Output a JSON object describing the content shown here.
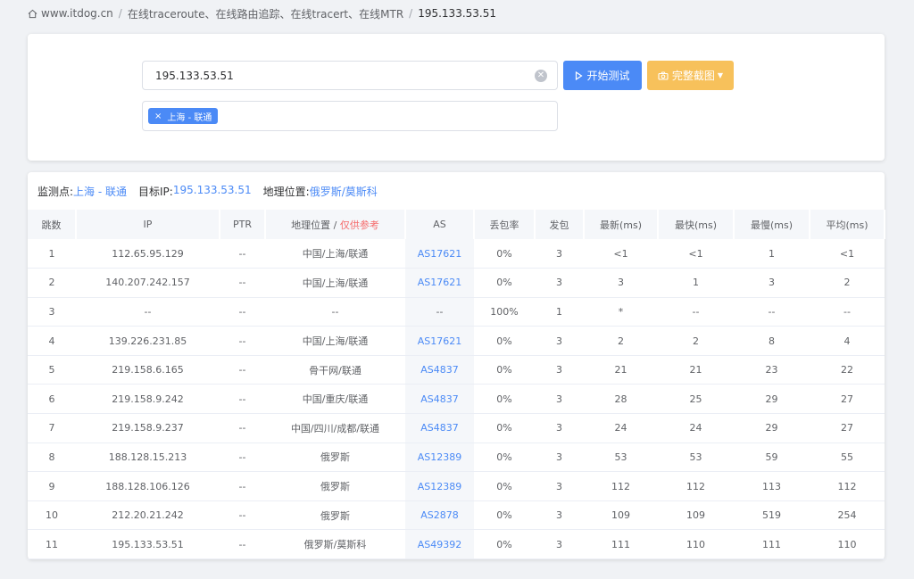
{
  "breadcrumb": {
    "site": "www.itdog.cn",
    "section": "在线traceroute、在线路由追踪、在线tracert、在线MTR",
    "current": "195.133.53.51"
  },
  "search": {
    "value": "195.133.53.51",
    "start_button": "开始测试",
    "screenshot_button": "完整截图",
    "tag_label": "上海 - 联通",
    "tag_close": "×"
  },
  "info": {
    "monitor_label": "监测点:",
    "monitor_value": "上海 - 联通",
    "target_label": "目标IP:",
    "target_value": "195.133.53.51",
    "geo_label": "地理位置:",
    "geo_value": "俄罗斯/莫斯科"
  },
  "table": {
    "headers": {
      "hop": "跳数",
      "ip": "IP",
      "ptr": "PTR",
      "geo": "地理位置 / ",
      "geo_note": "仅供参考",
      "as": "AS",
      "loss": "丢包率",
      "sent": "发包",
      "last": "最新(ms)",
      "best": "最快(ms)",
      "worst": "最慢(ms)",
      "avg": "平均(ms)"
    },
    "rows": [
      {
        "hop": "1",
        "ip": "112.65.95.129",
        "ptr": "--",
        "geo": "中国/上海/联通",
        "as": "AS17621",
        "loss": "0%",
        "sent": "3",
        "last": "<1",
        "best": "<1",
        "worst": "1",
        "avg": "<1"
      },
      {
        "hop": "2",
        "ip": "140.207.242.157",
        "ptr": "--",
        "geo": "中国/上海/联通",
        "as": "AS17621",
        "loss": "0%",
        "sent": "3",
        "last": "3",
        "best": "1",
        "worst": "3",
        "avg": "2"
      },
      {
        "hop": "3",
        "ip": "--",
        "ptr": "--",
        "geo": "--",
        "as": "--",
        "loss": "100%",
        "sent": "1",
        "last": "*",
        "best": "--",
        "worst": "--",
        "avg": "--"
      },
      {
        "hop": "4",
        "ip": "139.226.231.85",
        "ptr": "--",
        "geo": "中国/上海/联通",
        "as": "AS17621",
        "loss": "0%",
        "sent": "3",
        "last": "2",
        "best": "2",
        "worst": "8",
        "avg": "4"
      },
      {
        "hop": "5",
        "ip": "219.158.6.165",
        "ptr": "--",
        "geo": "骨干网/联通",
        "as": "AS4837",
        "loss": "0%",
        "sent": "3",
        "last": "21",
        "best": "21",
        "worst": "23",
        "avg": "22"
      },
      {
        "hop": "6",
        "ip": "219.158.9.242",
        "ptr": "--",
        "geo": "中国/重庆/联通",
        "as": "AS4837",
        "loss": "0%",
        "sent": "3",
        "last": "28",
        "best": "25",
        "worst": "29",
        "avg": "27"
      },
      {
        "hop": "7",
        "ip": "219.158.9.237",
        "ptr": "--",
        "geo": "中国/四川/成都/联通",
        "as": "AS4837",
        "loss": "0%",
        "sent": "3",
        "last": "24",
        "best": "24",
        "worst": "29",
        "avg": "27"
      },
      {
        "hop": "8",
        "ip": "188.128.15.213",
        "ptr": "--",
        "geo": "俄罗斯",
        "as": "AS12389",
        "loss": "0%",
        "sent": "3",
        "last": "53",
        "best": "53",
        "worst": "59",
        "avg": "55"
      },
      {
        "hop": "9",
        "ip": "188.128.106.126",
        "ptr": "--",
        "geo": "俄罗斯",
        "as": "AS12389",
        "loss": "0%",
        "sent": "3",
        "last": "112",
        "best": "112",
        "worst": "113",
        "avg": "112"
      },
      {
        "hop": "10",
        "ip": "212.20.21.242",
        "ptr": "--",
        "geo": "俄罗斯",
        "as": "AS2878",
        "loss": "0%",
        "sent": "3",
        "last": "109",
        "best": "109",
        "worst": "519",
        "avg": "254"
      },
      {
        "hop": "11",
        "ip": "195.133.53.51",
        "ptr": "--",
        "geo": "俄罗斯/莫斯科",
        "as": "AS49392",
        "loss": "0%",
        "sent": "3",
        "last": "111",
        "best": "110",
        "worst": "111",
        "avg": "110"
      }
    ]
  },
  "colors": {
    "primary": "#4b8af6",
    "warning": "#f7c15b",
    "danger": "#f56c6c"
  }
}
